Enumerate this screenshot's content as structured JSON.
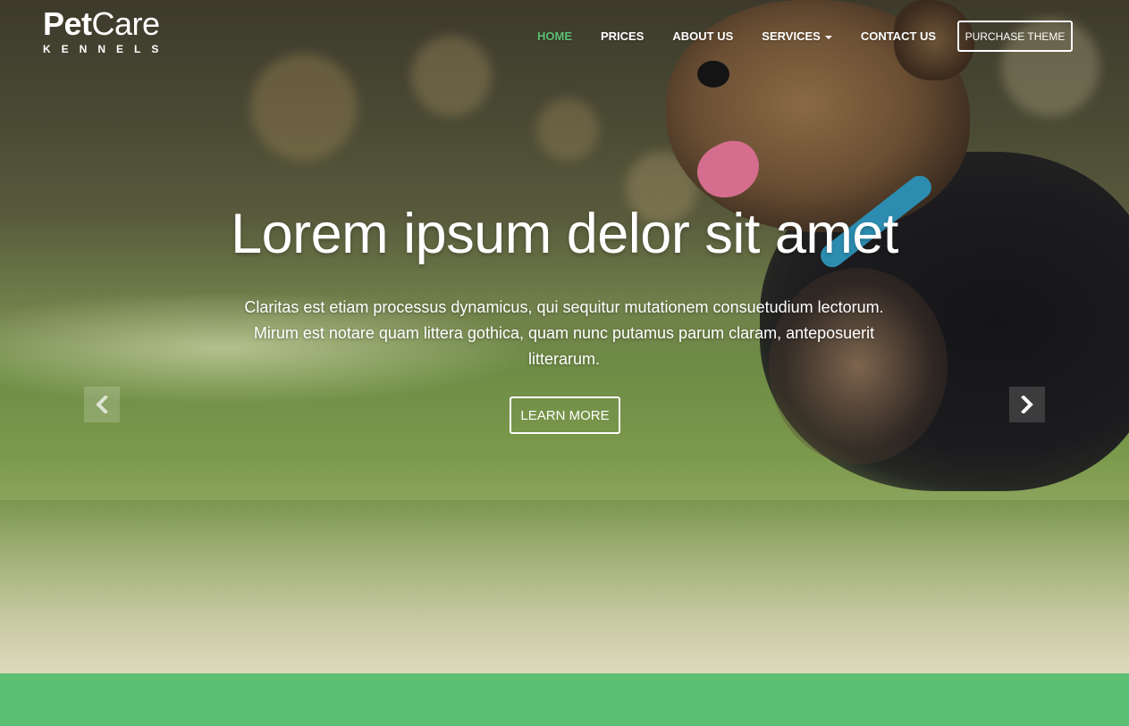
{
  "brand": {
    "name_bold": "Pet",
    "name_light": "Care",
    "subtitle": "KENNELS"
  },
  "nav": {
    "items": [
      {
        "label": "HOME",
        "active": true
      },
      {
        "label": "PRICES",
        "active": false
      },
      {
        "label": "ABOUT US",
        "active": false
      },
      {
        "label": "SERVICES",
        "active": false,
        "has_dropdown": true
      },
      {
        "label": "CONTACT US",
        "active": false
      }
    ],
    "cta_label": "PURCHASE THEME"
  },
  "hero": {
    "headline": "Lorem ipsum delor sit amet",
    "lead": "Claritas est etiam processus dynamicus, qui sequitur mutationem consuetudium lectorum. Mirum est notare quam littera gothica, quam nunc putamus parum claram, anteposuerit litterarum.",
    "button_label": "LEARN MORE",
    "prev_icon": "chevron-left-icon",
    "next_icon": "chevron-right-icon"
  },
  "colors": {
    "accent": "#5cbf73",
    "text_light": "#ffffff"
  }
}
